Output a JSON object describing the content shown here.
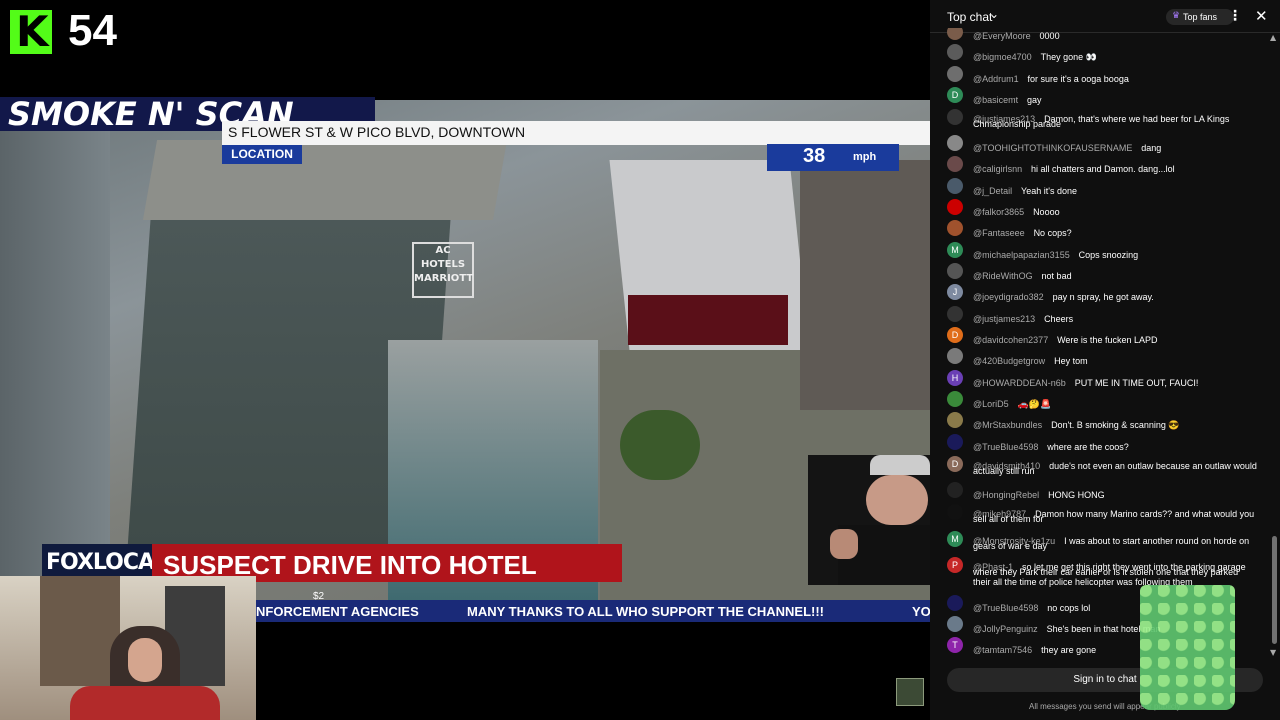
{
  "stream": {
    "viewer_count": "54",
    "kick_logo": "K",
    "show_title": "SMOKE N' SCAN",
    "street": "S FLOWER ST & W PICO BLVD, DOWNTOWN",
    "location_tag": "LOCATION",
    "speed_value": "38",
    "speed_unit": "mph",
    "network": "FOXLOCAL",
    "headline": "SUSPECT DRIVE INTO HOTEL",
    "donation": "$2",
    "ticker": [
      "NFORCEMENT AGENCIES",
      "MANY THANKS TO ALL WHO SUPPORT THE CHANNEL!!!",
      "YO"
    ],
    "hotel_sign": "AC HOTELS MARRIOTT"
  },
  "chat": {
    "header": {
      "title": "Top chat",
      "top_fans_label": "Top fans"
    },
    "messages": [
      {
        "author": "@EveryMoore",
        "text": "0000",
        "color": "#7a5c4a",
        "initial": ""
      },
      {
        "author": "@bigmoe4700",
        "text": "They gone 👀",
        "color": "#5b5b5b",
        "initial": ""
      },
      {
        "author": "@Addrum1",
        "text": "for sure it's a ooga booga",
        "color": "#6e6e6e",
        "initial": ""
      },
      {
        "author": "@basicemt",
        "text": "gay",
        "color": "#2e8b57",
        "initial": "D"
      },
      {
        "author": "@justjames213",
        "text": "Damon, that's where we had beer for LA Kings",
        "text2": "Chmapionship parade",
        "color": "#333333",
        "initial": ""
      },
      {
        "author": "@TOOHIGHTOTHINKOFAUSERNAME",
        "text": "dang",
        "color": "#888888",
        "initial": ""
      },
      {
        "author": "@caligirlsnn",
        "text": "hi all chatters and Damon. dang...lol",
        "color": "#6a4a4a",
        "initial": ""
      },
      {
        "author": "@j_Detail",
        "text": "Yeah it's done",
        "color": "#4a5a6a",
        "initial": ""
      },
      {
        "author": "@falkor3865",
        "text": "Noooo",
        "color": "#cc0000",
        "initial": ""
      },
      {
        "author": "@Fantaseee",
        "text": "No cops?",
        "color": "#a0522d",
        "initial": ""
      },
      {
        "author": "@michaelpapazian3155",
        "text": "Cops snoozing",
        "color": "#2e8b57",
        "initial": "M"
      },
      {
        "author": "@RideWithOG",
        "text": "not bad",
        "color": "#555555",
        "initial": ""
      },
      {
        "author": "@joeydigrado382",
        "text": "pay n spray, he got away.",
        "color": "#7e8aa0",
        "initial": "J"
      },
      {
        "author": "@justjames213",
        "text": "Cheers",
        "color": "#333333",
        "initial": ""
      },
      {
        "author": "@davidcohen2377",
        "text": "Were is the fucken LAPD",
        "color": "#e06d1a",
        "initial": "D"
      },
      {
        "author": "@420Budgetgrow",
        "text": "Hey tom",
        "color": "#7a7a7a",
        "initial": ""
      },
      {
        "author": "@HOWARDDEAN-n6b",
        "text": "PUT ME IN TIME OUT, FAUCI!",
        "color": "#6a3fb5",
        "initial": "H"
      },
      {
        "author": "@LoriD5",
        "text": "🚗🤔🚨",
        "color": "#3a8a3a",
        "initial": ""
      },
      {
        "author": "@MrStaxbundles",
        "text": "Don't. B smoking & scanning 😎",
        "color": "#8a7a4a",
        "initial": ""
      },
      {
        "author": "@TrueBlue4598",
        "text": "where are the coos?",
        "color": "#1a1a5a",
        "initial": ""
      },
      {
        "author": "@davidsmith410",
        "text": "dude's not even an outlaw because an outlaw would",
        "text2": "actually still run",
        "color": "#8a6a5a",
        "initial": "D"
      },
      {
        "author": "@HongingRebel",
        "text": "HONG HONG",
        "color": "#222222",
        "initial": ""
      },
      {
        "author": "@mikeh9787",
        "text": "Damon how many Marino cards?? and what would you",
        "text2": "sell all of them for",
        "color": "#111111",
        "initial": ""
      },
      {
        "author": "@Monstrosity-ke1zu",
        "text": "I was about to start another round on horde on",
        "text2": "gears of war e day",
        "color": "#2e8b57",
        "initial": "M"
      },
      {
        "author": "@Phast-1",
        "text": "so let me get this right they went into the parking garage",
        "text2": "where they Park their car earlier or is it stolen one that they parked",
        "text3": "their all the time of police helicopter was following them",
        "color": "#c62828",
        "initial": "P"
      },
      {
        "author": "@TrueBlue4598",
        "text": "no cops lol",
        "color": "#1a1a5a",
        "initial": ""
      },
      {
        "author": "@JollyPenguinz",
        "text": "She's been in that hotel man",
        "color": "#6a7a8a",
        "initial": ""
      },
      {
        "author": "@tamtam7546",
        "text": "they are gone",
        "color": "#8e24aa",
        "initial": "T"
      }
    ],
    "signin_label": "Sign in to chat",
    "disclaimer": "All messages you send will appear publicly"
  }
}
